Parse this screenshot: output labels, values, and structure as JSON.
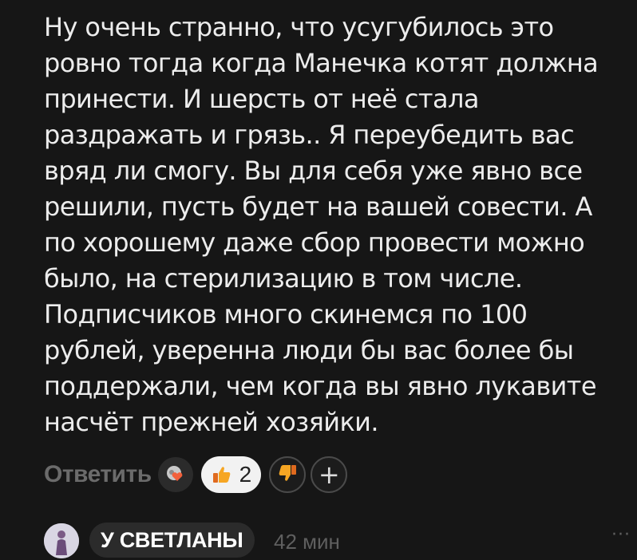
{
  "comment": {
    "text": "Ну очень странно, что усугубилось это\nровно тогда когда Манечка котят должна\nпринести. И шерсть от неё стала\nраздражать и грязь.. Я переубедить вас\nвряд ли смогу. Вы для себя уже явно все\nрешили, пусть будет на вашей совести. А\nпо хорошему даже сбор провести можно\nбыло, на стерилизацию в том числе.\nПодписчиков много скинемся по 100\nрублей, уверенна люди бы вас более бы\nподдержали, чем когда вы явно лукавите\nнасчёт прежней хозяйки.",
    "reply_label": "Ответить",
    "reactions": [
      {
        "emoji_icon": "thumbs-up-icon",
        "count": "2"
      },
      {
        "emoji_icon": "thumbs-down-icon",
        "count": ""
      }
    ],
    "add_reaction_label": "+"
  },
  "next_comment": {
    "author_label": "У СВЕТЛАНЫ",
    "time": "42 мин",
    "more_label": "···"
  },
  "colors": {
    "background": "#161616",
    "text": "#ececec",
    "muted": "#6b6b6b",
    "pill": "#f2f2f2"
  }
}
